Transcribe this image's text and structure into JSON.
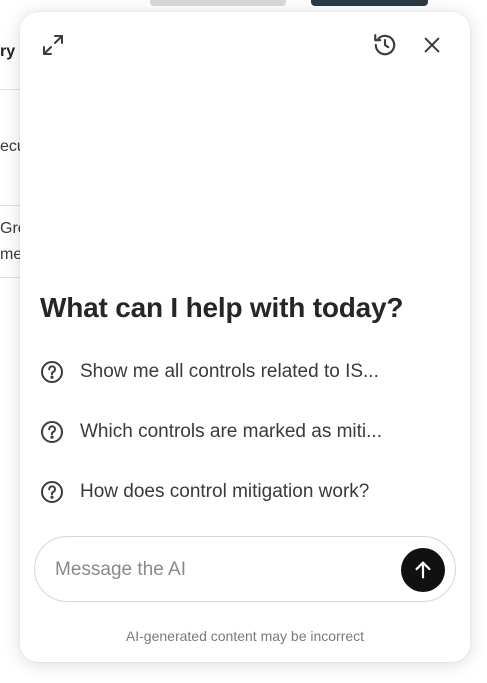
{
  "background": {
    "fragments": [
      "ry",
      "ecu",
      "Gro",
      "me"
    ]
  },
  "header": {
    "icons": [
      "expand-icon",
      "history-icon",
      "close-icon"
    ]
  },
  "main": {
    "headline": "What can I help with today?",
    "suggestions": [
      {
        "text": "Show me all controls related to IS...",
        "icon": "question-circle-icon"
      },
      {
        "text": "Which controls are marked as miti...",
        "icon": "question-circle-icon"
      },
      {
        "text": "How does control mitigation work?",
        "icon": "question-circle-icon"
      }
    ]
  },
  "composer": {
    "placeholder": "Message the AI",
    "value": "",
    "send_icon": "arrow-up-icon"
  },
  "footer": {
    "disclaimer": "AI-generated content may be incorrect"
  },
  "colors": {
    "send_button": "#111111",
    "panel_bg": "#ffffff",
    "text": "#262626"
  }
}
